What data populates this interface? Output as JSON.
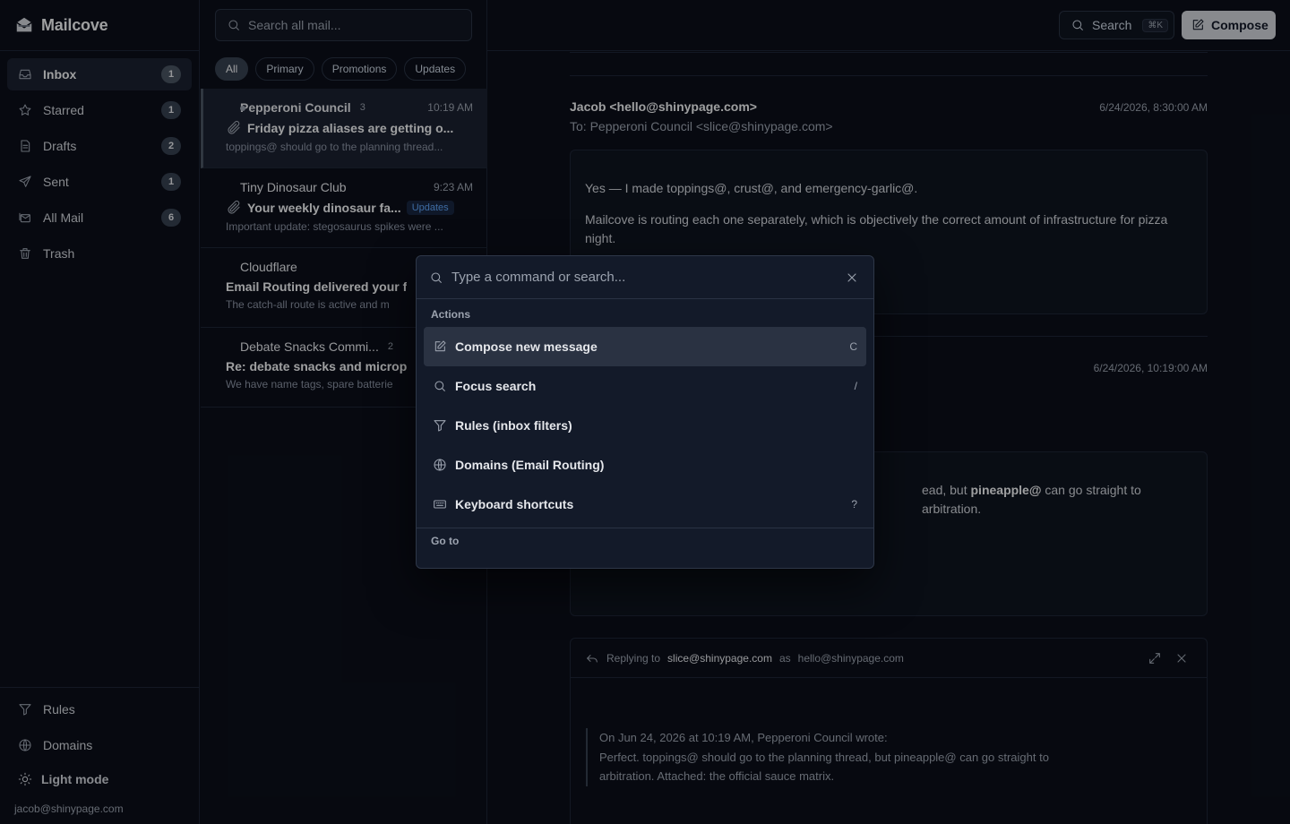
{
  "app": {
    "name": "Mailcove"
  },
  "sidebar": {
    "items": [
      {
        "label": "Inbox",
        "count": "1",
        "icon": "inbox-icon"
      },
      {
        "label": "Starred",
        "count": "1",
        "icon": "star-icon"
      },
      {
        "label": "Drafts",
        "count": "2",
        "icon": "drafts-icon"
      },
      {
        "label": "Sent",
        "count": "1",
        "icon": "send-icon"
      },
      {
        "label": "All Mail",
        "count": "6",
        "icon": "all-mail-icon"
      },
      {
        "label": "Trash",
        "count": "",
        "icon": "trash-icon"
      }
    ],
    "bottom": {
      "rules": "Rules",
      "domains": "Domains",
      "light_mode": "Light mode",
      "account": "jacob@shinypage.com"
    }
  },
  "list": {
    "search_placeholder": "Search all mail...",
    "filters": [
      "All",
      "Primary",
      "Promotions",
      "Updates"
    ],
    "rows": [
      {
        "sender": "Pepperoni Council",
        "thread_count": "3",
        "time": "10:19 AM",
        "subject": "Friday pizza aliases are getting o...",
        "preview": "toppings@ should go to the planning thread...",
        "badge": ""
      },
      {
        "sender": "Tiny Dinosaur Club",
        "thread_count": "",
        "time": "9:23 AM",
        "subject": "Your weekly dinosaur fa...",
        "preview": "Important update: stegosaurus spikes were ...",
        "badge": "Updates"
      },
      {
        "sender": "Cloudflare",
        "thread_count": "",
        "time": "",
        "subject": "Email Routing delivered your f",
        "preview": "The catch-all route is active and m",
        "badge": ""
      },
      {
        "sender": "Debate Snacks Commi...",
        "thread_count": "2",
        "time": "",
        "subject": "Re: debate snacks and microp",
        "preview": "We have name tags, spare batterie",
        "badge": ""
      }
    ]
  },
  "topbar": {
    "search_label": "Search",
    "search_shortcut": "⌘K",
    "compose_label": "Compose"
  },
  "reading": {
    "message1": {
      "from": "Jacob <hello@shinypage.com>",
      "to": "To: Pepperoni Council <slice@shinypage.com>",
      "date": "6/24/2026, 8:30:00 AM",
      "paragraph1": "Yes — I made toppings@, crust@, and emergency-garlic@.",
      "paragraph2": "Mailcove is routing each one separately, which is objectively the correct amount of infrastructure for pizza night."
    },
    "message2": {
      "date": "6/24/2026, 10:19:00 AM",
      "fragment_before": "ead, but ",
      "fragment_bold": "pineapple@",
      "fragment_after": " can go straight to arbitration."
    },
    "reply": {
      "prefix": "Replying to",
      "to": "slice@shinypage.com",
      "middle": "as",
      "as_address": "hello@shinypage.com",
      "quote_line1": "On Jun 24, 2026 at 10:19 AM, Pepperoni Council wrote:",
      "quote_line2": "Perfect. toppings@ should go to the planning thread, but pineapple@ can go straight to",
      "quote_line3": "arbitration. Attached: the official sauce matrix."
    }
  },
  "palette": {
    "placeholder": "Type a command or search...",
    "actions_title": "Actions",
    "actions": [
      {
        "label": "Compose new message",
        "shortcut": "C",
        "icon": "compose-icon"
      },
      {
        "label": "Focus search",
        "shortcut": "/",
        "icon": "search-icon"
      },
      {
        "label": "Rules (inbox filters)",
        "shortcut": "",
        "icon": "filter-icon"
      },
      {
        "label": "Domains (Email Routing)",
        "shortcut": "",
        "icon": "globe-icon"
      },
      {
        "label": "Keyboard shortcuts",
        "shortcut": "?",
        "icon": "keyboard-icon"
      }
    ],
    "goto_title": "Go to"
  },
  "colors": {
    "background": "#0b0f1a",
    "accent_updates": "#60a5fa",
    "compose_button": "#d1d5db"
  }
}
